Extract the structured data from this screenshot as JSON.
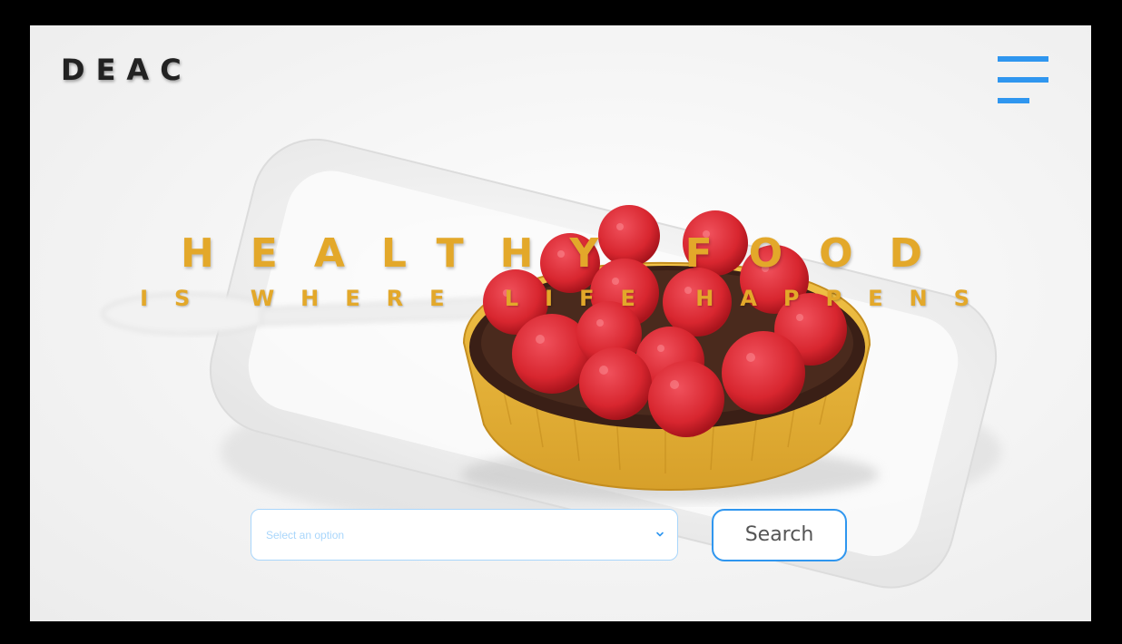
{
  "header": {
    "logo": "DEAC",
    "menu_icon": "hamburger-menu-icon"
  },
  "hero": {
    "title": "HEALTHY FOOD",
    "subtitle": "IS WHERE LIFE HAPPENS",
    "image": "raspberry-tart-photo"
  },
  "search": {
    "select_placeholder": "Select an option",
    "select_icon": "chevron-down-icon",
    "button_label": "Search"
  },
  "colors": {
    "accent": "#2f96ef",
    "headline": "#e3a82a",
    "logo": "#222222",
    "placeholder": "#a9d6fb",
    "frame_border": "#000000"
  }
}
